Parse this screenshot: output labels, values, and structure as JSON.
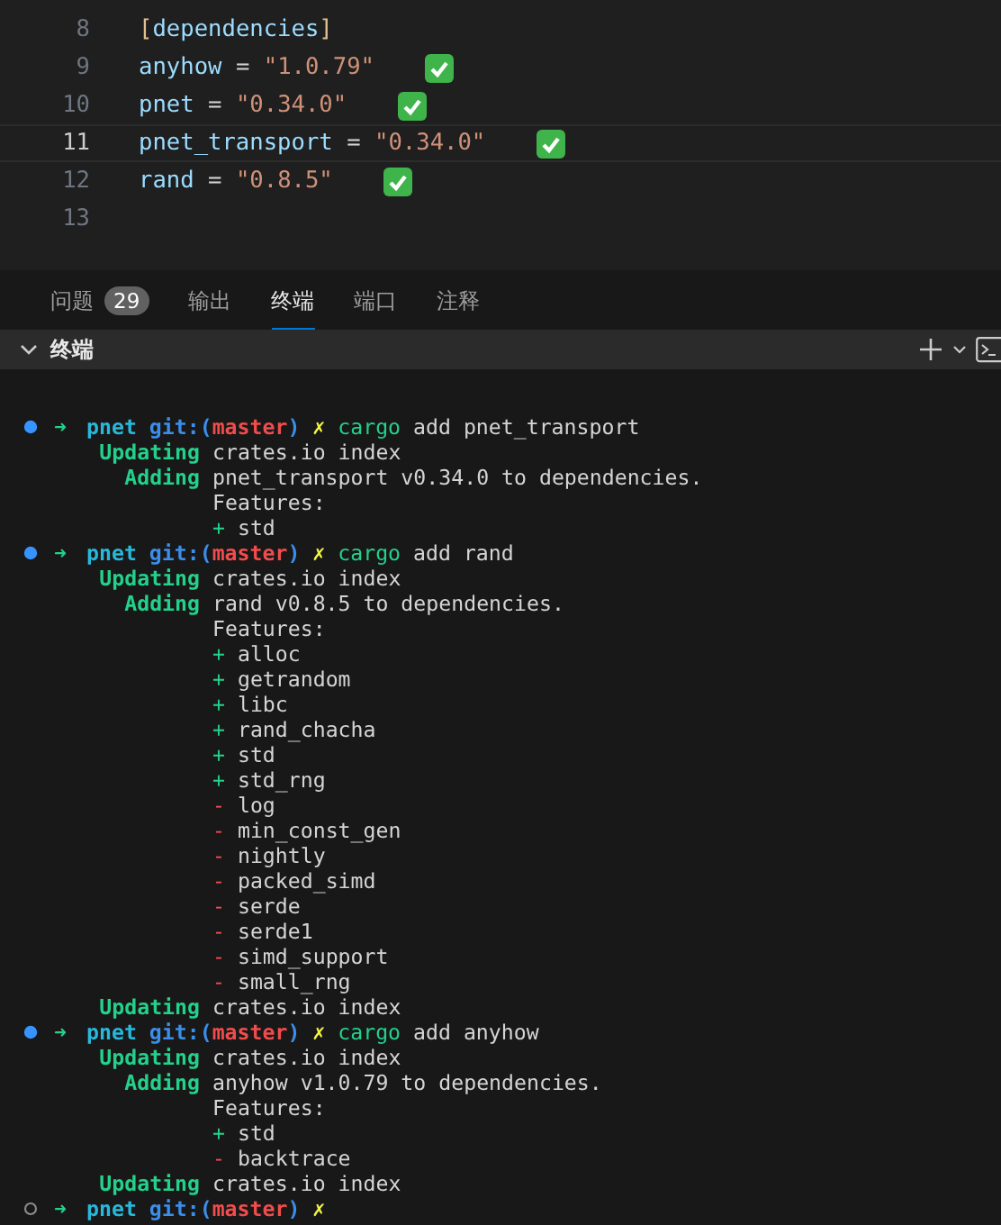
{
  "editor": {
    "lines": [
      {
        "number": "8",
        "current": false,
        "checkmark": false,
        "tokens": [
          {
            "kind": "bracket",
            "text": "["
          },
          {
            "kind": "section",
            "text": "dependencies"
          },
          {
            "kind": "bracket",
            "text": "]"
          }
        ]
      },
      {
        "number": "9",
        "current": false,
        "checkmark": true,
        "tokens": [
          {
            "kind": "key",
            "text": "anyhow"
          },
          {
            "kind": "punct",
            "text": " = "
          },
          {
            "kind": "string",
            "text": "\"1.0.79\""
          }
        ]
      },
      {
        "number": "10",
        "current": false,
        "checkmark": true,
        "tokens": [
          {
            "kind": "key",
            "text": "pnet"
          },
          {
            "kind": "punct",
            "text": " = "
          },
          {
            "kind": "string",
            "text": "\"0.34.0\""
          }
        ]
      },
      {
        "number": "11",
        "current": true,
        "checkmark": true,
        "tokens": [
          {
            "kind": "key",
            "text": "pnet_transport"
          },
          {
            "kind": "punct",
            "text": " = "
          },
          {
            "kind": "string",
            "text": "\"0.34.0\""
          }
        ]
      },
      {
        "number": "12",
        "current": false,
        "checkmark": true,
        "tokens": [
          {
            "kind": "key",
            "text": "rand"
          },
          {
            "kind": "punct",
            "text": " = "
          },
          {
            "kind": "string",
            "text": "\"0.8.5\""
          }
        ]
      },
      {
        "number": "13",
        "current": false,
        "checkmark": false
      }
    ]
  },
  "panel_tabs": [
    {
      "label": "问题",
      "badge": "29",
      "selected": false
    },
    {
      "label": "输出",
      "selected": false
    },
    {
      "label": "终端",
      "selected": true
    },
    {
      "label": "端口",
      "selected": false
    },
    {
      "label": "注释",
      "selected": false
    }
  ],
  "terminal": {
    "title": "终端",
    "lines": [
      {
        "kind": "prompt",
        "finished": true,
        "arrow": "➜",
        "dir": "pnet",
        "git": "git:(",
        "branch": "master",
        "close": ")",
        "dirty": "✗",
        "command": "cargo",
        "args": "add pnet_transport"
      },
      {
        "kind": "status",
        "label": "Updating",
        "text": "crates.io index"
      },
      {
        "kind": "status",
        "label": "Adding",
        "text": "pnet_transport v0.34.0 to dependencies."
      },
      {
        "kind": "text",
        "text": "Features:"
      },
      {
        "kind": "feature",
        "enabled": true,
        "sign": "+",
        "name": "std"
      },
      {
        "kind": "prompt",
        "finished": true,
        "arrow": "➜",
        "dir": "pnet",
        "git": "git:(",
        "branch": "master",
        "close": ")",
        "dirty": "✗",
        "command": "cargo",
        "args": "add rand"
      },
      {
        "kind": "status",
        "label": "Updating",
        "text": "crates.io index"
      },
      {
        "kind": "status",
        "label": "Adding",
        "text": "rand v0.8.5 to dependencies."
      },
      {
        "kind": "text",
        "text": "Features:"
      },
      {
        "kind": "feature",
        "enabled": true,
        "sign": "+",
        "name": "alloc"
      },
      {
        "kind": "feature",
        "enabled": true,
        "sign": "+",
        "name": "getrandom"
      },
      {
        "kind": "feature",
        "enabled": true,
        "sign": "+",
        "name": "libc"
      },
      {
        "kind": "feature",
        "enabled": true,
        "sign": "+",
        "name": "rand_chacha"
      },
      {
        "kind": "feature",
        "enabled": true,
        "sign": "+",
        "name": "std"
      },
      {
        "kind": "feature",
        "enabled": true,
        "sign": "+",
        "name": "std_rng"
      },
      {
        "kind": "feature",
        "enabled": false,
        "sign": "-",
        "name": "log"
      },
      {
        "kind": "feature",
        "enabled": false,
        "sign": "-",
        "name": "min_const_gen"
      },
      {
        "kind": "feature",
        "enabled": false,
        "sign": "-",
        "name": "nightly"
      },
      {
        "kind": "feature",
        "enabled": false,
        "sign": "-",
        "name": "packed_simd"
      },
      {
        "kind": "feature",
        "enabled": false,
        "sign": "-",
        "name": "serde"
      },
      {
        "kind": "feature",
        "enabled": false,
        "sign": "-",
        "name": "serde1"
      },
      {
        "kind": "feature",
        "enabled": false,
        "sign": "-",
        "name": "simd_support"
      },
      {
        "kind": "feature",
        "enabled": false,
        "sign": "-",
        "name": "small_rng"
      },
      {
        "kind": "status",
        "label": "Updating",
        "text": "crates.io index"
      },
      {
        "kind": "prompt",
        "finished": true,
        "arrow": "➜",
        "dir": "pnet",
        "git": "git:(",
        "branch": "master",
        "close": ")",
        "dirty": "✗",
        "command": "cargo",
        "args": "add anyhow"
      },
      {
        "kind": "status",
        "label": "Updating",
        "text": "crates.io index"
      },
      {
        "kind": "status",
        "label": "Adding",
        "text": "anyhow v1.0.79 to dependencies."
      },
      {
        "kind": "text",
        "text": "Features:"
      },
      {
        "kind": "feature",
        "enabled": true,
        "sign": "+",
        "name": "std"
      },
      {
        "kind": "feature",
        "enabled": false,
        "sign": "-",
        "name": "backtrace"
      },
      {
        "kind": "status",
        "label": "Updating",
        "text": "crates.io index"
      },
      {
        "kind": "prompt",
        "finished": false,
        "arrow": "➜",
        "dir": "pnet",
        "git": "git:(",
        "branch": "master",
        "close": ")",
        "dirty": "✗"
      }
    ]
  }
}
